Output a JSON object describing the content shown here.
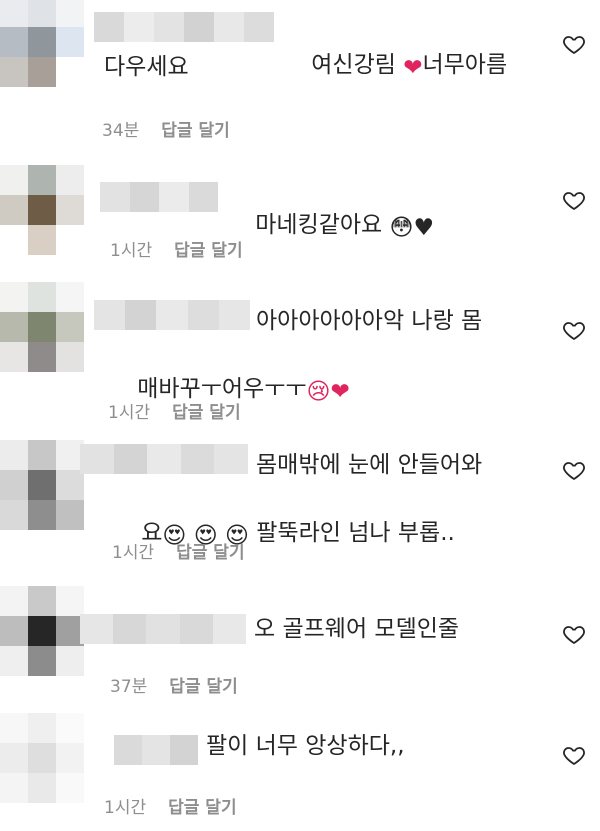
{
  "comments": [
    {
      "text_line1": "여신강림 ",
      "emoji1": "❤",
      "text_line1b": "너무아름",
      "text_line2": "다우세요",
      "time": "34분",
      "reply": "답글 달기"
    },
    {
      "text_line1": "마네킹같아요 ",
      "emoji1": "😳♥",
      "time": "1시간",
      "reply": "답글 달기"
    },
    {
      "text_line1": "아아아아아아악 나랑 몸",
      "text_line2": "매바꾸ㅜ어우ㅜㅜ",
      "emoji2": "😢❤",
      "time": "1시간",
      "reply": "답글 달기"
    },
    {
      "text_line1": "몸매밖에 눈에 안들어와",
      "text_line2a": "요",
      "emoji2": "😍 😍 😍",
      "text_line2b": " 팔뚝라인 넘나 부롭..",
      "time": "1시간",
      "reply": "답글 달기"
    },
    {
      "text_line1": "오 골프웨어 모델인줄",
      "time": "37분",
      "reply": "답글 달기"
    },
    {
      "text_line1": "팔이 너무 앙상하다,,",
      "time": "1시간",
      "reply": "답글 달기"
    }
  ],
  "colors": {
    "text": "#262626",
    "meta": "#8e8e8e",
    "heart": "#262626",
    "heart_emoji": "#e0245e"
  },
  "icons": {
    "like": "heart-outline-icon"
  }
}
